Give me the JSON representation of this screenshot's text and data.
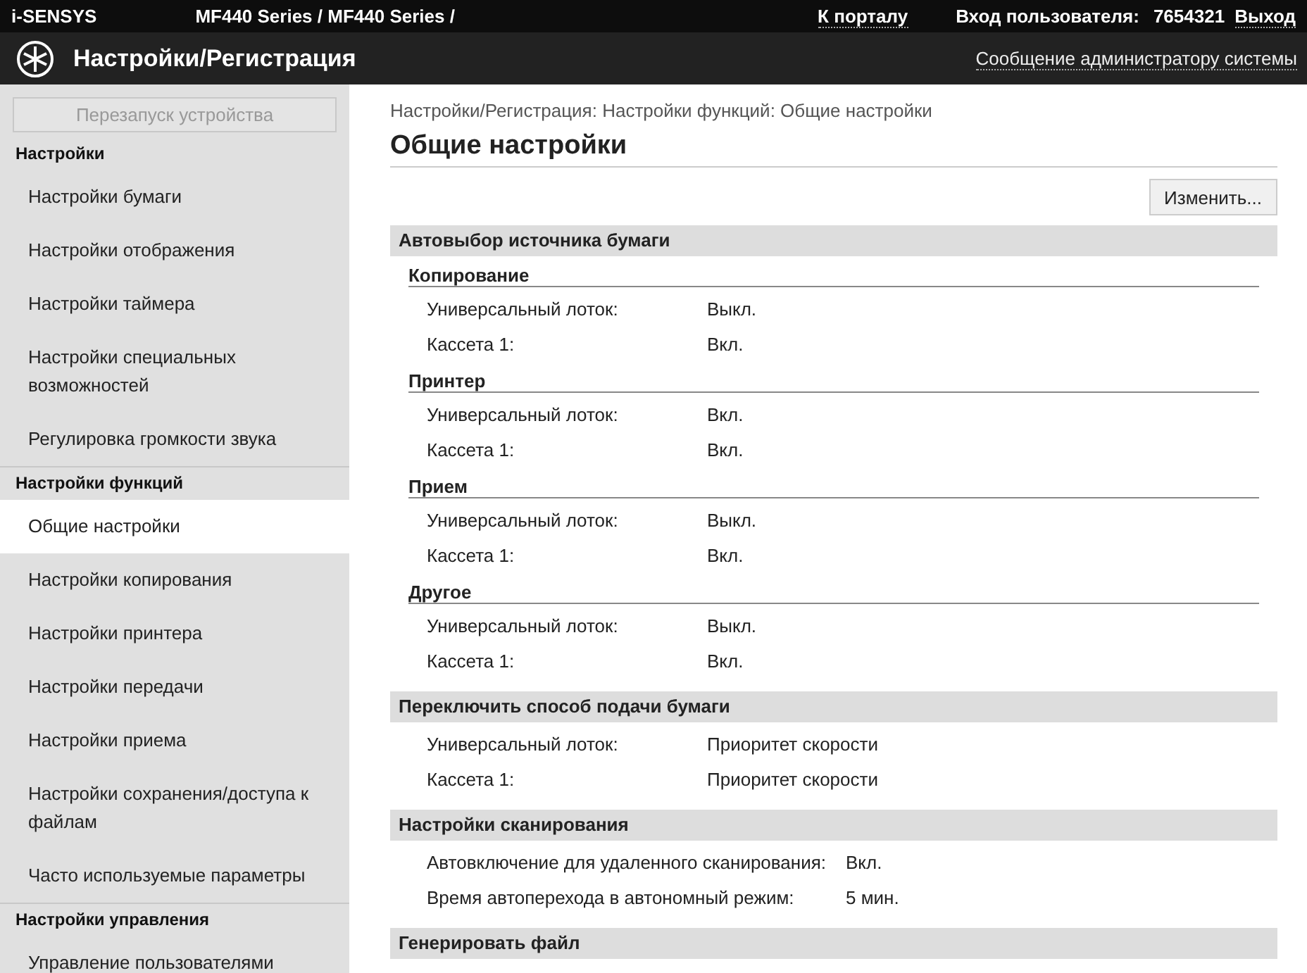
{
  "top_bar": {
    "brand": "i-SENSYS",
    "device": "MF440 Series / MF440 Series /",
    "portal_link": "К порталу",
    "login_label": "Вход пользователя:",
    "login_user": "7654321",
    "logout_link": "Выход"
  },
  "header": {
    "title": "Настройки/Регистрация",
    "admin_link": "Сообщение администратору системы"
  },
  "sidebar": {
    "restart_button": {
      "label": "Перезапуск устройства",
      "disabled": true
    },
    "groups": [
      {
        "title": "Настройки",
        "items": [
          {
            "label": "Настройки бумаги",
            "selected": false
          },
          {
            "label": "Настройки отображения",
            "selected": false
          },
          {
            "label": "Настройки таймера",
            "selected": false
          },
          {
            "label": "Настройки специальных возможностей",
            "selected": false
          },
          {
            "label": "Регулировка громкости звука",
            "selected": false
          }
        ]
      },
      {
        "title": "Настройки функций",
        "items": [
          {
            "label": "Общие настройки",
            "selected": true
          },
          {
            "label": "Настройки копирования",
            "selected": false
          },
          {
            "label": "Настройки принтера",
            "selected": false
          },
          {
            "label": "Настройки передачи",
            "selected": false
          },
          {
            "label": "Настройки приема",
            "selected": false
          },
          {
            "label": "Настройки сохранения/доступа к файлам",
            "selected": false
          },
          {
            "label": "Часто используемые параметры",
            "selected": false
          }
        ]
      },
      {
        "title": "Настройки управления",
        "items": [
          {
            "label": "Управление пользователями",
            "selected": false
          }
        ]
      }
    ]
  },
  "breadcrumb": "Настройки/Регистрация: Настройки функций: Общие настройки",
  "page_title": "Общие настройки",
  "edit_button": "Изменить...",
  "sections": [
    {
      "title": "Автовыбор источника бумаги",
      "groups": [
        {
          "title": "Копирование",
          "rows": [
            {
              "label": "Универсальный лоток:",
              "value": "Выкл."
            },
            {
              "label": "Кассета 1:",
              "value": "Вкл."
            }
          ]
        },
        {
          "title": "Принтер",
          "rows": [
            {
              "label": "Универсальный лоток:",
              "value": "Вкл."
            },
            {
              "label": "Кассета 1:",
              "value": "Вкл."
            }
          ]
        },
        {
          "title": "Прием",
          "rows": [
            {
              "label": "Универсальный лоток:",
              "value": "Выкл."
            },
            {
              "label": "Кассета 1:",
              "value": "Вкл."
            }
          ]
        },
        {
          "title": "Другое",
          "rows": [
            {
              "label": "Универсальный лоток:",
              "value": "Выкл."
            },
            {
              "label": "Кассета 1:",
              "value": "Вкл."
            }
          ]
        }
      ]
    },
    {
      "title": "Переключить способ подачи бумаги",
      "rows": [
        {
          "label": "Универсальный лоток:",
          "value": "Приоритет скорости"
        },
        {
          "label": "Кассета 1:",
          "value": "Приоритет скорости"
        }
      ]
    },
    {
      "title": "Настройки сканирования",
      "rows": [
        {
          "label": "Автовключение для удаленного сканирования:",
          "value": "Вкл."
        },
        {
          "label": "Время автоперехода в автономный режим:",
          "value": "5 мин."
        }
      ]
    },
    {
      "title": "Генерировать файл"
    }
  ]
}
